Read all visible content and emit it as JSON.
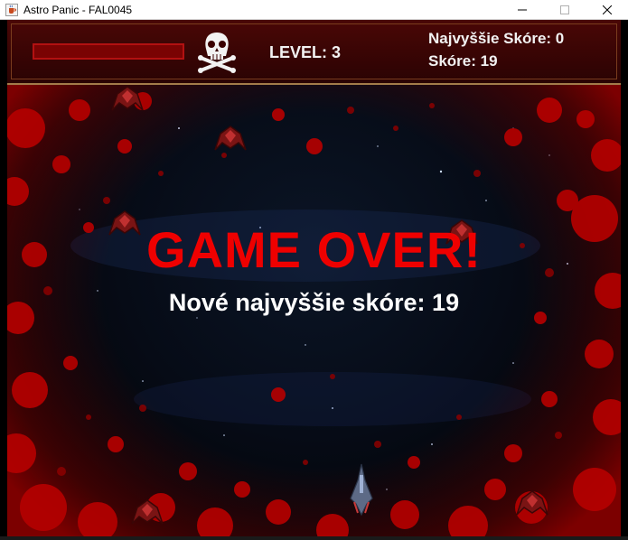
{
  "window": {
    "title": "Astro Panic -  FAL0045",
    "controls": [
      "minimize",
      "maximize",
      "close"
    ],
    "icon": "java-cup-icon"
  },
  "hud": {
    "level_text": "LEVEL: 3",
    "high_score_text": "Najvyššie Skóre: 0",
    "score_text": "Skóre: 19",
    "health_fraction": 0.0,
    "skull_icon": "skull-crossbones-icon"
  },
  "overlay": {
    "game_over_text": "GAME OVER!",
    "new_high_score_text": "Nové najvyššie skóre: 19"
  },
  "colors": {
    "game_over": "#ee0000",
    "blood": "#b00000",
    "hud_background": "#3a0505",
    "text": "#ffffff"
  }
}
